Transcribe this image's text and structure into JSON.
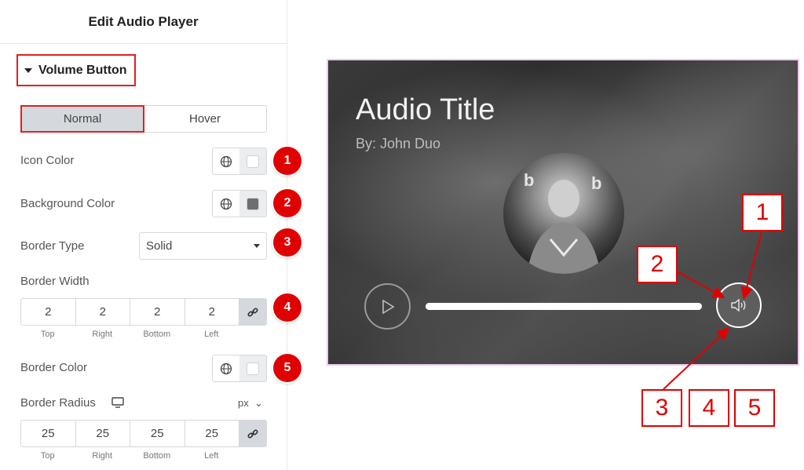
{
  "panel": {
    "title": "Edit Audio Player",
    "section_label": "Volume Button",
    "tabs": [
      {
        "label": "Normal",
        "active": true
      },
      {
        "label": "Hover",
        "active": false
      }
    ],
    "icon_color": {
      "label": "Icon Color",
      "swatch": "#ffffff",
      "badge": "1"
    },
    "background_color": {
      "label": "Background Color",
      "swatch": "#6f6f6f",
      "badge": "2"
    },
    "border_type": {
      "label": "Border Type",
      "value": "Solid",
      "badge": "3"
    },
    "border_width": {
      "label": "Border Width",
      "values": [
        "2",
        "2",
        "2",
        "2"
      ],
      "sides": [
        "Top",
        "Right",
        "Bottom",
        "Left"
      ],
      "badge": "4",
      "link_icon": "link-icon"
    },
    "border_color": {
      "label": "Border Color",
      "swatch": "#ffffff",
      "badge": "5"
    },
    "border_radius": {
      "label": "Border Radius",
      "unit": "px",
      "device_icon": "monitor-icon",
      "values": [
        "25",
        "25",
        "25",
        "25"
      ],
      "sides": [
        "Top",
        "Right",
        "Bottom",
        "Left"
      ],
      "link_icon": "link-icon"
    },
    "colors": {
      "accent_red": "#e00000",
      "tab_active_bg": "#d5d8dc"
    }
  },
  "preview": {
    "title": "Audio Title",
    "artist": "By: John Duo",
    "progress": 1.0,
    "play_icon": "play-icon",
    "volume_icon": "volume-icon"
  },
  "callouts": {
    "box1": "1",
    "box2": "2",
    "box3": "3",
    "box4": "4",
    "box5": "5"
  }
}
